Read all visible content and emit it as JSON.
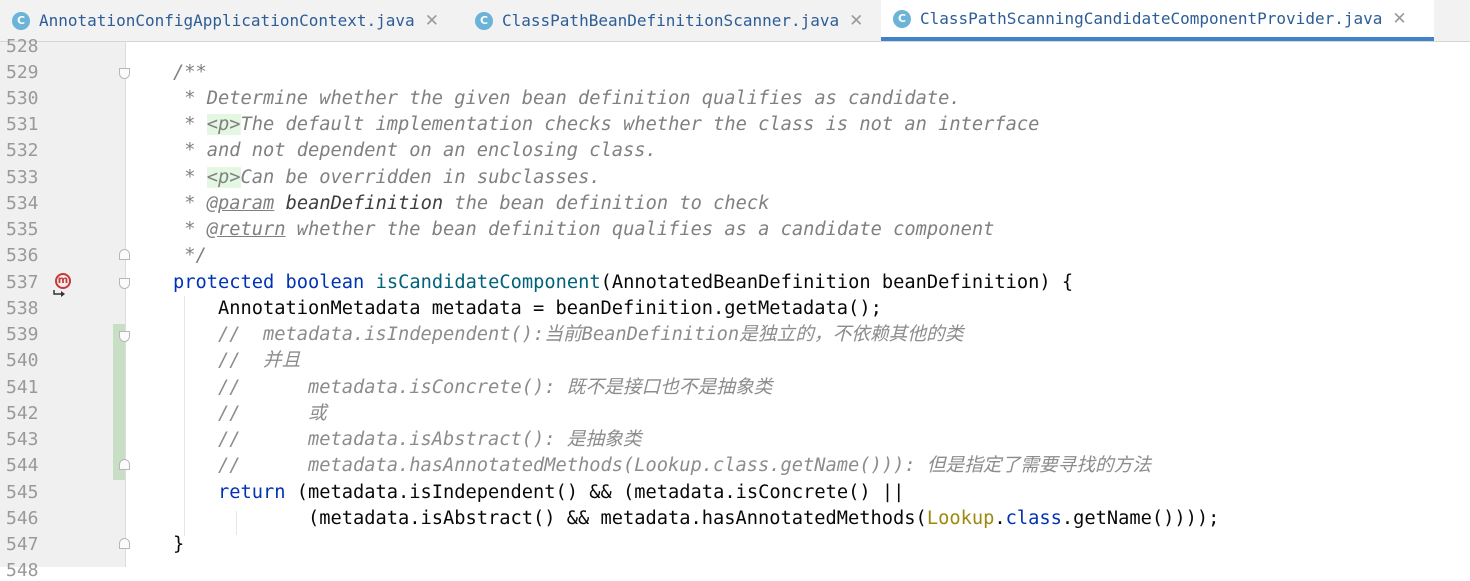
{
  "tabs": [
    {
      "icon": "C",
      "label": "AnnotationConfigApplicationContext.java",
      "close": "✕",
      "active": false
    },
    {
      "icon": "C",
      "label": "ClassPathBeanDefinitionScanner.java",
      "close": "✕",
      "active": false
    },
    {
      "icon": "C",
      "label": "ClassPathScanningCandidateComponentProvider.java",
      "close": "✕",
      "active": true
    }
  ],
  "gutter": {
    "line_numbers": [
      "528",
      "529",
      "530",
      "531",
      "532",
      "533",
      "534",
      "535",
      "536",
      "537",
      "538",
      "539",
      "540",
      "541",
      "542",
      "543",
      "544",
      "545",
      "546",
      "547",
      "548"
    ],
    "override_marker": "m"
  },
  "code": {
    "l529": "/**",
    "l530": " * Determine whether the given bean definition qualifies as candidate.",
    "l531_star": " * ",
    "l531_tag": "<p>",
    "l531_text": "The default implementation checks whether the class is not an interface",
    "l532": " * and not dependent on an enclosing class.",
    "l533_star": " * ",
    "l533_tag": "<p>",
    "l533_text": "Can be overridden in subclasses.",
    "l534_star": " * ",
    "l534_tag": "@param",
    "l534_param": "beanDefinition",
    "l534_text": " the bean definition to check",
    "l535_star": " * ",
    "l535_tag": "@return",
    "l535_text": " whether the bean definition qualifies as a candidate component",
    "l536": " */",
    "l537_kw1": "protected",
    "l537_kw2": "boolean",
    "l537_method": "isCandidateComponent",
    "l537_rest": "(AnnotatedBeanDefinition beanDefinition) {",
    "l538": "AnnotationMetadata metadata = beanDefinition.getMetadata();",
    "l539": "//  metadata.isIndependent():当前BeanDefinition是独立的，不依赖其他的类",
    "l540": "//  并且",
    "l541": "//      metadata.isConcrete(): 既不是接口也不是抽象类",
    "l542": "//      或",
    "l543": "//      metadata.isAbstract(): 是抽象类",
    "l544": "//      metadata.hasAnnotatedMethods(Lookup.class.getName())): 但是指定了需要寻找的方法",
    "l545_kw": "return",
    "l545_rest": " (metadata.isIndependent() && (metadata.isConcrete() ||",
    "l546_a": "(metadata.isAbstract() && metadata.hasAnnotatedMethods(",
    "l546_cls": "Lookup",
    "l546_dot": ".",
    "l546_kw": "class",
    "l546_end": ".getName())));",
    "l547": "}"
  },
  "colors": {
    "keyword": "#0033b3",
    "method": "#00627a",
    "comment": "#8c8c8c",
    "annotation_class": "#9e880d",
    "tab_active_underline": "#4083c9",
    "tab_icon": "#6bb3d8"
  }
}
